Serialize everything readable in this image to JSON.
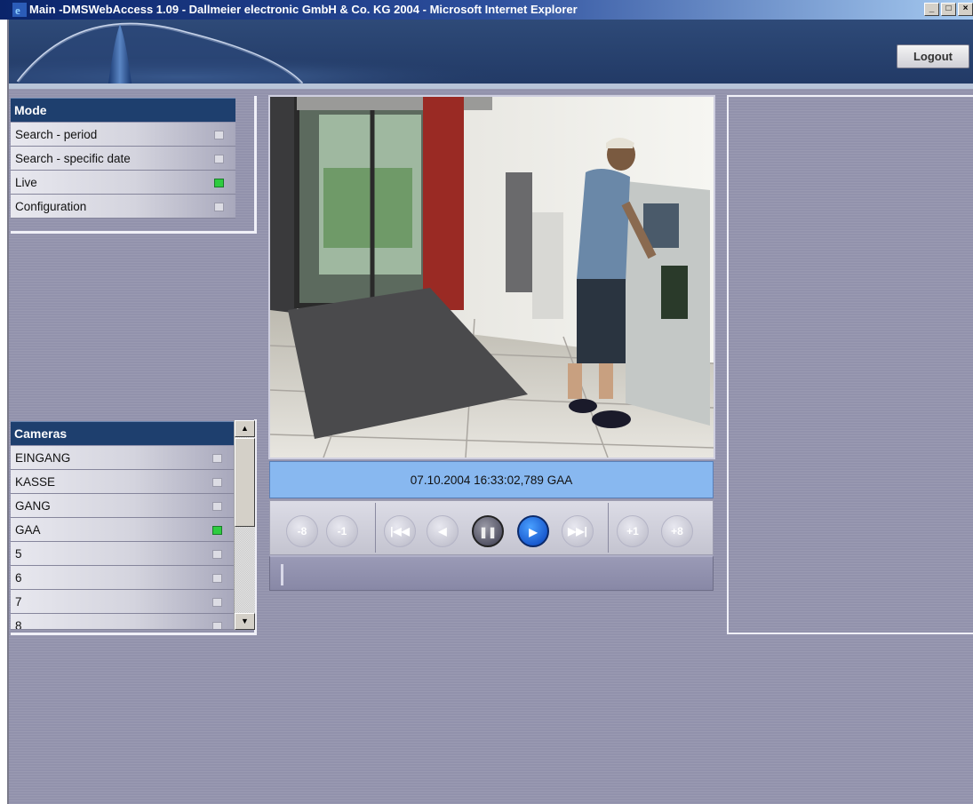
{
  "window": {
    "title": "Main -DMSWebAccess 1.09 - Dallmeier electronic GmbH & Co. KG 2004 - Microsoft Internet Explorer",
    "minimize": "_",
    "maximize": "□",
    "close": "×"
  },
  "header": {
    "logout_label": "Logout"
  },
  "mode": {
    "title": "Mode",
    "items": [
      {
        "label": "Search - period",
        "selected": false
      },
      {
        "label": "Search - specific date",
        "selected": false
      },
      {
        "label": "Live",
        "selected": true
      },
      {
        "label": "Configuration",
        "selected": false
      }
    ]
  },
  "cameras": {
    "title": "Cameras",
    "items": [
      {
        "label": "EINGANG",
        "selected": false
      },
      {
        "label": "KASSE",
        "selected": false
      },
      {
        "label": "GANG",
        "selected": false
      },
      {
        "label": "GAA",
        "selected": true
      },
      {
        "label": "5",
        "selected": false
      },
      {
        "label": "6",
        "selected": false
      },
      {
        "label": "7",
        "selected": false
      },
      {
        "label": "8",
        "selected": false
      }
    ]
  },
  "player": {
    "timestamp": "07.10.2004 16:33:02,789 GAA",
    "buttons": {
      "back8": "-8",
      "back1": "-1",
      "first": "|◀◀",
      "prev": "◀",
      "pause": "❚❚",
      "play": "▶",
      "last": "▶▶|",
      "fwd1": "+1",
      "fwd8": "+8"
    }
  },
  "colors": {
    "accent": "#1e3f6e",
    "selected_indicator": "#2ecc40",
    "timestamp_bg": "#88b8f0"
  }
}
